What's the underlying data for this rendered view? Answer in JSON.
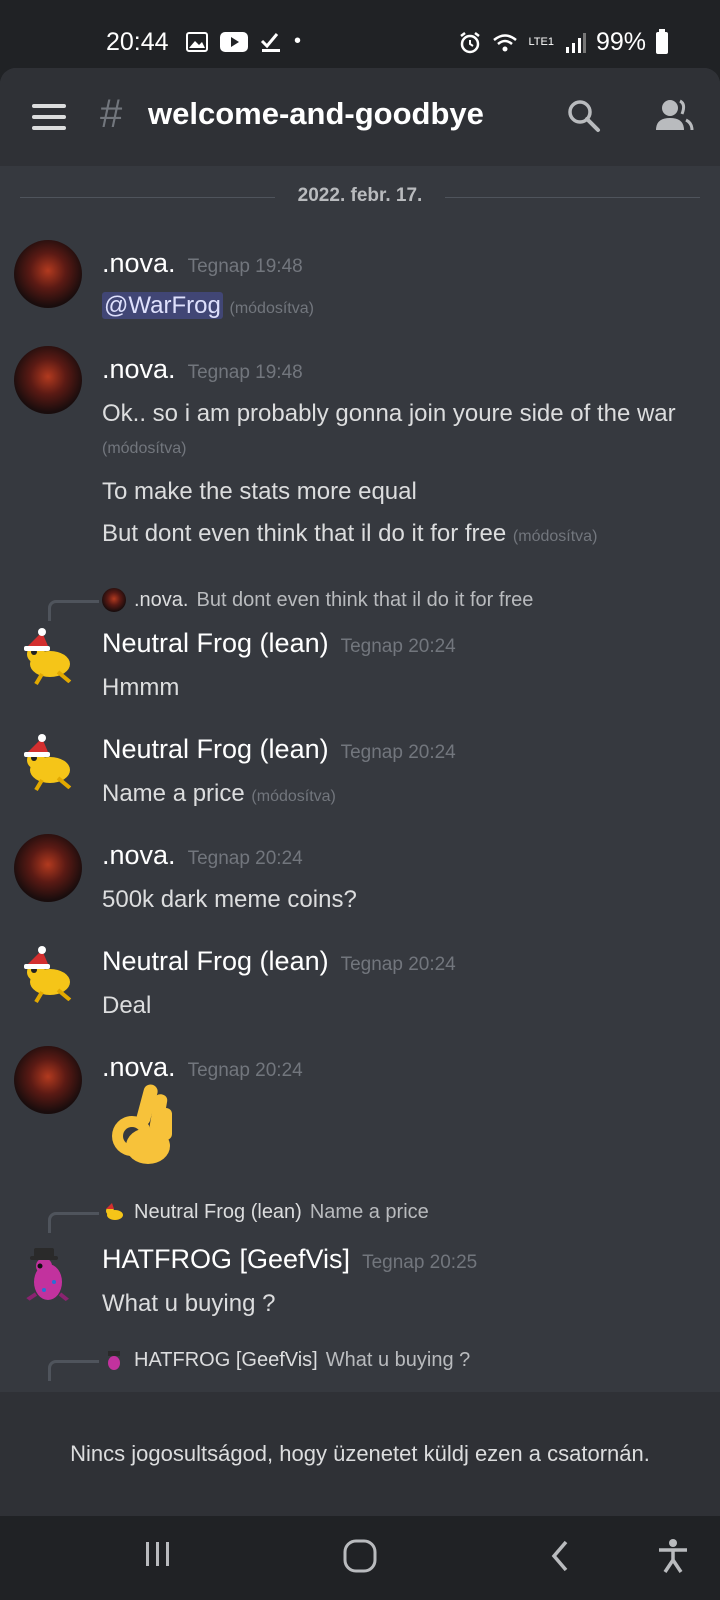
{
  "status_bar": {
    "time": "20:44",
    "battery": "99%",
    "network": "LTE1"
  },
  "header": {
    "hash": "#",
    "channel": "welcome-and-goodbye"
  },
  "date_divider": "2022. febr. 17.",
  "messages": [
    {
      "author": ".nova.",
      "time": "Tegnap 19:48",
      "mention": "@WarFrog",
      "edited": "(módosítva)"
    },
    {
      "author": ".nova.",
      "time": "Tegnap 19:48",
      "line1": "Ok.. so i am probably gonna join youre side of the war",
      "line1_edited": "(módosítva)",
      "line2": "To make the stats more equal",
      "line3": "But dont even think that il do it for free",
      "line3_edited": "(módosítva)"
    },
    {
      "reply_author": ".nova.",
      "reply_text": "But dont even think that il do it for free",
      "author": "Neutral Frog (lean)",
      "time": "Tegnap 20:24",
      "text": "Hmmm"
    },
    {
      "author": "Neutral Frog (lean)",
      "time": "Tegnap 20:24",
      "text": "Name a price",
      "edited": "(módosítva)"
    },
    {
      "author": ".nova.",
      "time": "Tegnap 20:24",
      "text": "500k dark meme coins?"
    },
    {
      "author": "Neutral Frog (lean)",
      "time": "Tegnap 20:24",
      "text": "Deal"
    },
    {
      "author": ".nova.",
      "time": "Tegnap 20:24",
      "emoji": "👌"
    },
    {
      "reply_author": "Neutral Frog (lean)",
      "reply_text": "Name a price",
      "author": "HATFROG [GeefVis]",
      "time": "Tegnap 20:25",
      "text": "What u buying ?"
    },
    {
      "reply_author": "HATFROG [GeefVis]",
      "reply_text": "What u buying ?"
    }
  ],
  "no_permission": "Nincs jogosultságod, hogy üzenetet küldj ezen a csatornán.",
  "colors": {
    "background": "#36393f",
    "header": "#2f3136",
    "mention_bg": "#414675"
  }
}
